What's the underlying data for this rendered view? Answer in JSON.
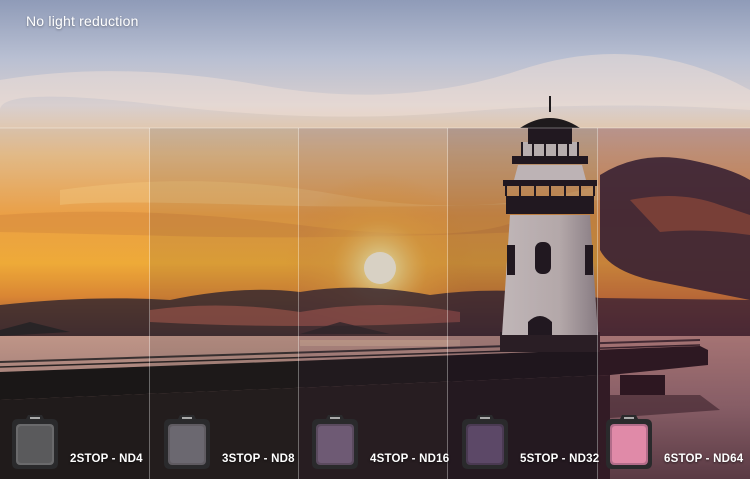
{
  "caption": "No light reduction",
  "filters": [
    {
      "label": "2STOP - ND4",
      "icon": "nd4-filter-icon",
      "tint": "#6a6a6c",
      "glass": "#5a5a5c"
    },
    {
      "label": "3STOP - ND8",
      "icon": "nd8-filter-icon",
      "tint": "#5f5b61",
      "glass": "#6b6870"
    },
    {
      "label": "4STOP - ND16",
      "icon": "nd16-filter-icon",
      "tint": "#5a4a5e",
      "glass": "#6e5a74"
    },
    {
      "label": "5STOP - ND32",
      "icon": "nd32-filter-icon",
      "tint": "#4a3a52",
      "glass": "#5c4867"
    },
    {
      "label": "6STOP - ND64",
      "icon": "nd64-filter-icon",
      "tint": "#b26d8a",
      "glass": "#e08aa8"
    }
  ]
}
